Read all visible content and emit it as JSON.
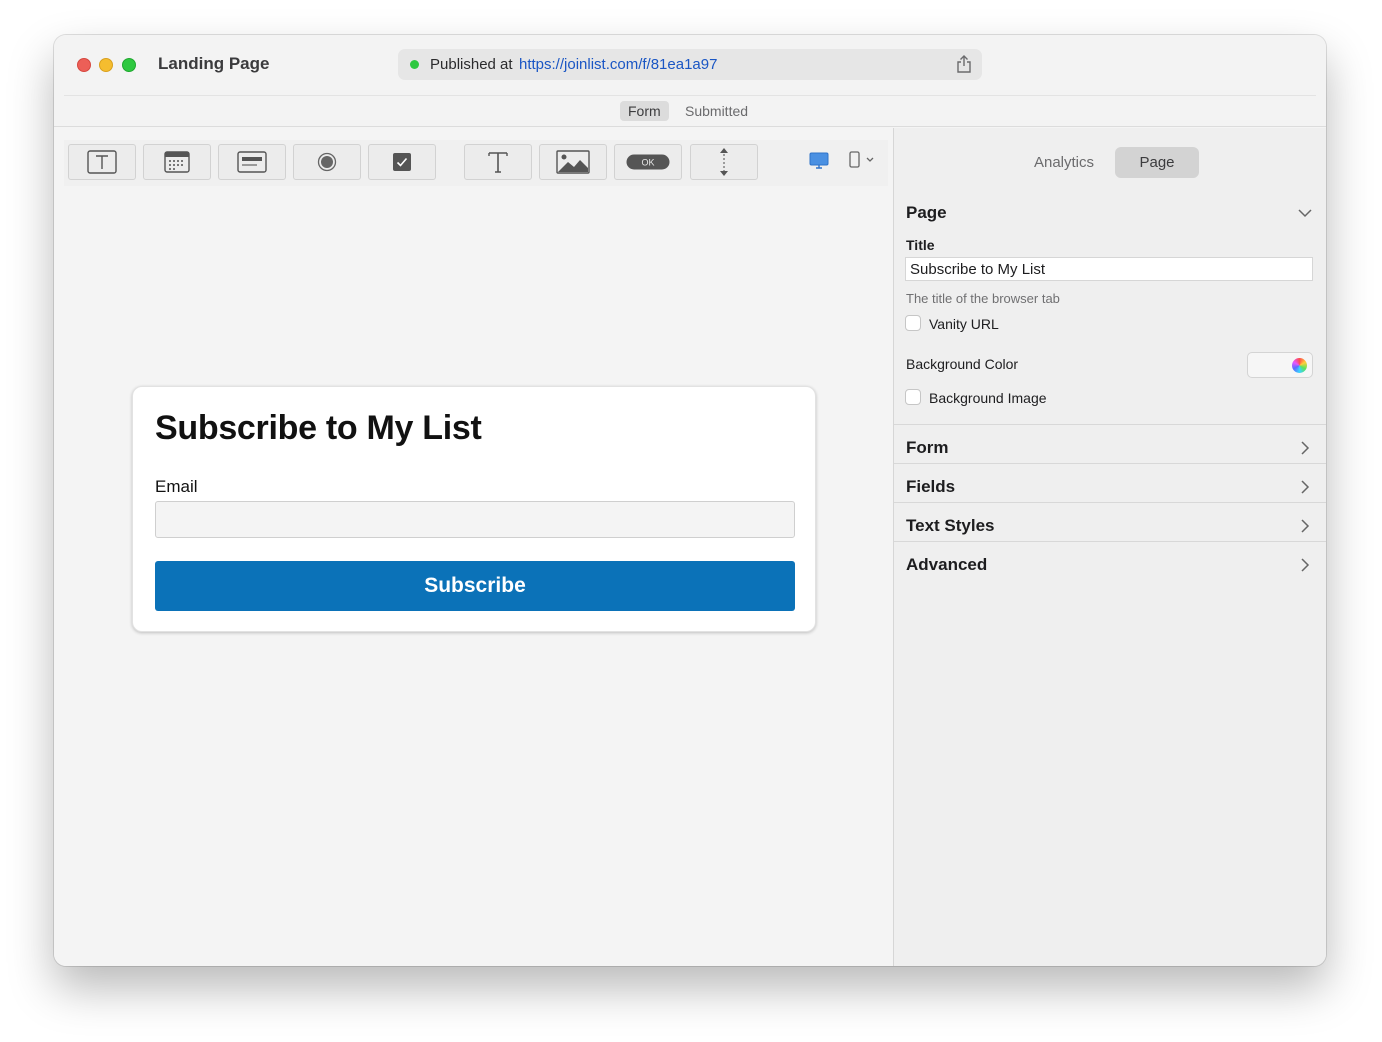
{
  "window": {
    "title": "Landing Page",
    "published_label": "Published at",
    "published_url": "https://joinlist.com/f/81ea1a97",
    "modes": [
      {
        "label": "Form",
        "selected": true
      },
      {
        "label": "Submitted",
        "selected": false
      }
    ]
  },
  "toolbar": {
    "tools": [
      "text-field-icon",
      "date-field-icon",
      "dropdown-field-icon",
      "radio-button-icon",
      "checkbox-icon",
      "text-block-icon",
      "image-icon",
      "button-icon",
      "spacer-icon"
    ],
    "button_tool_label": "OK",
    "device_preview": [
      "desktop-icon",
      "mobile-icon"
    ]
  },
  "form_preview": {
    "title": "Subscribe to My List",
    "email_label": "Email",
    "email_value": "",
    "submit_label": "Subscribe",
    "accent": "#0b72b8"
  },
  "inspector": {
    "tabs": [
      {
        "label": "Analytics",
        "selected": false
      },
      {
        "label": "Page",
        "selected": true
      }
    ],
    "page_section": {
      "heading": "Page",
      "title_label": "Title",
      "title_value": "Subscribe to My List",
      "title_help": "The title of the browser tab",
      "vanity_url_label": "Vanity URL",
      "vanity_url_checked": false,
      "background_color_label": "Background Color",
      "background_image_label": "Background Image",
      "background_image_checked": false
    },
    "sections": [
      "Form",
      "Fields",
      "Text Styles",
      "Advanced"
    ]
  }
}
